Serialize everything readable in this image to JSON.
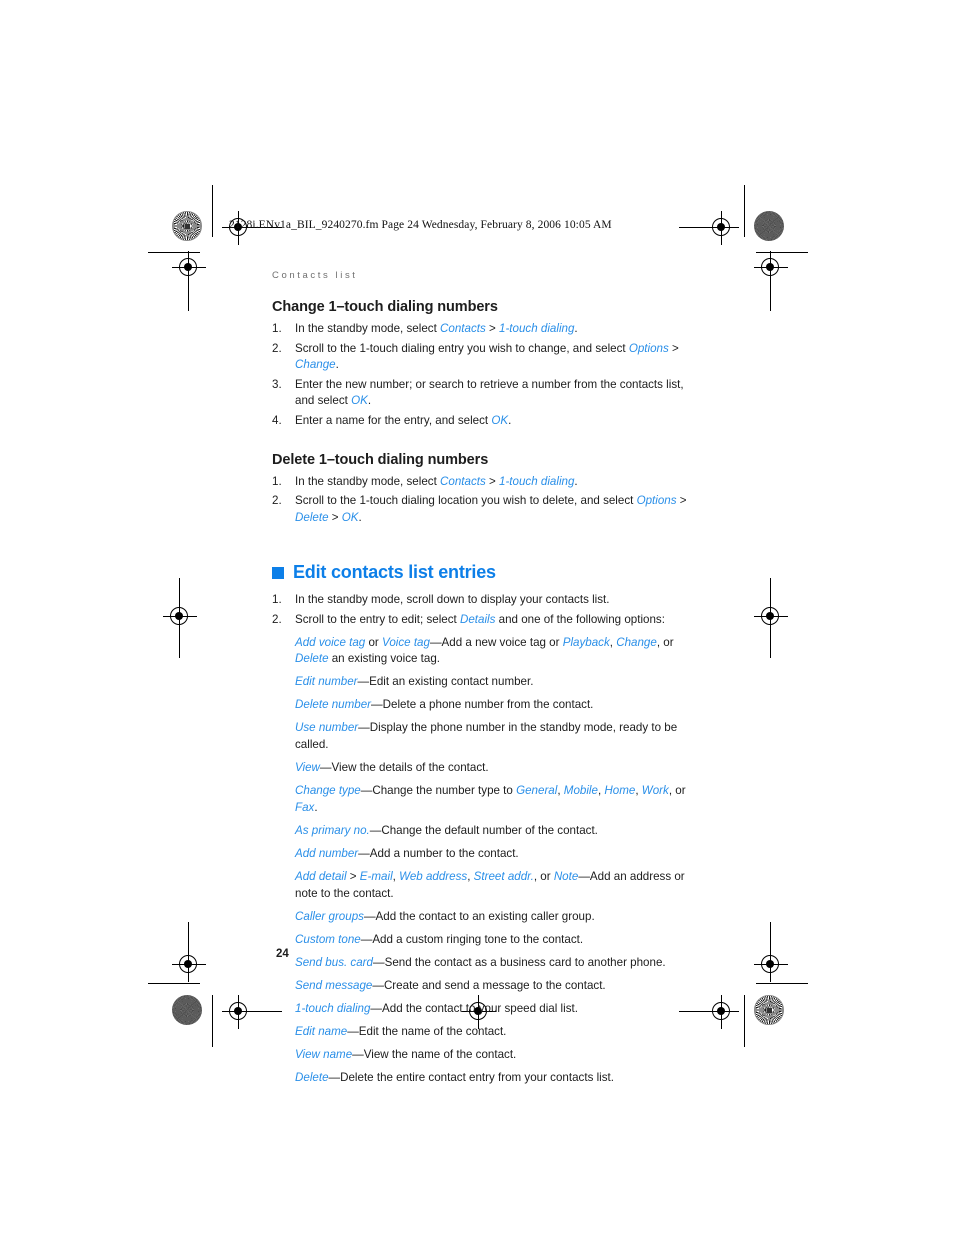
{
  "file_slug": "2128i.ENv1a_BIL_9240270.fm  Page 24  Wednesday, February 8, 2006  10:05 AM",
  "running_head": "Contacts list",
  "page_number": "24",
  "colors": {
    "accent_blue": "#0d7fe8",
    "ui_term_blue": "#2a8fe8",
    "body_text": "#1d1d1d",
    "running_head_gray": "#6f6f6f"
  },
  "sections": [
    {
      "heading": "Change 1–touch dialing numbers",
      "steps": [
        {
          "num": "1.",
          "parts": [
            {
              "t": "In the standby mode, select ",
              "s": "plain"
            },
            {
              "t": "Contacts",
              "s": "ui"
            },
            {
              "t": " > ",
              "s": "plain"
            },
            {
              "t": "1-touch dialing",
              "s": "ui"
            },
            {
              "t": ".",
              "s": "plain"
            }
          ]
        },
        {
          "num": "2.",
          "parts": [
            {
              "t": "Scroll to the 1-touch dialing entry you wish to change, and select ",
              "s": "plain"
            },
            {
              "t": "Options",
              "s": "ui"
            },
            {
              "t": " > ",
              "s": "plain"
            },
            {
              "t": "Change",
              "s": "ui"
            },
            {
              "t": ".",
              "s": "plain"
            }
          ]
        },
        {
          "num": "3.",
          "parts": [
            {
              "t": "Enter the new number; or search to retrieve a number from the contacts list, and select ",
              "s": "plain"
            },
            {
              "t": "OK",
              "s": "ui"
            },
            {
              "t": ".",
              "s": "plain"
            }
          ]
        },
        {
          "num": "4.",
          "parts": [
            {
              "t": "Enter a name for the entry, and select ",
              "s": "plain"
            },
            {
              "t": "OK",
              "s": "ui"
            },
            {
              "t": ".",
              "s": "plain"
            }
          ]
        }
      ]
    },
    {
      "heading": "Delete 1–touch dialing numbers",
      "steps": [
        {
          "num": "1.",
          "parts": [
            {
              "t": "In the standby mode, select ",
              "s": "plain"
            },
            {
              "t": "Contacts",
              "s": "ui"
            },
            {
              "t": " > ",
              "s": "plain"
            },
            {
              "t": "1-touch dialing",
              "s": "ui"
            },
            {
              "t": ".",
              "s": "plain"
            }
          ]
        },
        {
          "num": "2.",
          "parts": [
            {
              "t": "Scroll to the 1-touch dialing location you wish to delete, and select ",
              "s": "plain"
            },
            {
              "t": "Options",
              "s": "ui"
            },
            {
              "t": " > ",
              "s": "plain"
            },
            {
              "t": "Delete",
              "s": "ui"
            },
            {
              "t": " > ",
              "s": "plain"
            },
            {
              "t": "OK",
              "s": "ui"
            },
            {
              "t": ".",
              "s": "plain"
            }
          ]
        }
      ]
    }
  ],
  "main_section": {
    "bullet_icon": "blue-square-bullet",
    "heading": "Edit contacts list entries",
    "steps": [
      {
        "num": "1.",
        "parts": [
          {
            "t": "In the standby mode, scroll down to display your contacts list.",
            "s": "plain"
          }
        ]
      },
      {
        "num": "2.",
        "parts": [
          {
            "t": "Scroll to the entry to edit; select ",
            "s": "plain"
          },
          {
            "t": "Details",
            "s": "ui"
          },
          {
            "t": " and one of the following options:",
            "s": "plain"
          }
        ]
      }
    ],
    "options": [
      [
        {
          "t": "Add voice tag",
          "s": "ui"
        },
        {
          "t": " or ",
          "s": "plain"
        },
        {
          "t": "Voice tag",
          "s": "ui"
        },
        {
          "t": "—Add a new voice tag or ",
          "s": "plain"
        },
        {
          "t": "Playback",
          "s": "ui"
        },
        {
          "t": ", ",
          "s": "plain"
        },
        {
          "t": "Change",
          "s": "ui"
        },
        {
          "t": ", or ",
          "s": "plain"
        },
        {
          "t": "Delete",
          "s": "ui"
        },
        {
          "t": " an existing voice tag.",
          "s": "plain"
        }
      ],
      [
        {
          "t": "Edit number",
          "s": "ui"
        },
        {
          "t": "—Edit an existing contact number.",
          "s": "plain"
        }
      ],
      [
        {
          "t": "Delete number",
          "s": "ui"
        },
        {
          "t": "—Delete a phone number from the contact.",
          "s": "plain"
        }
      ],
      [
        {
          "t": "Use number",
          "s": "ui"
        },
        {
          "t": "—Display the phone number in the standby mode, ready to be called.",
          "s": "plain"
        }
      ],
      [
        {
          "t": "View",
          "s": "ui"
        },
        {
          "t": "—View the details of the contact.",
          "s": "plain"
        }
      ],
      [
        {
          "t": "Change type",
          "s": "ui"
        },
        {
          "t": "—Change the number type to ",
          "s": "plain"
        },
        {
          "t": "General",
          "s": "ui"
        },
        {
          "t": ", ",
          "s": "plain"
        },
        {
          "t": "Mobile",
          "s": "ui"
        },
        {
          "t": ", ",
          "s": "plain"
        },
        {
          "t": "Home",
          "s": "ui"
        },
        {
          "t": ", ",
          "s": "plain"
        },
        {
          "t": "Work",
          "s": "ui"
        },
        {
          "t": ", or ",
          "s": "plain"
        },
        {
          "t": "Fax",
          "s": "ui"
        },
        {
          "t": ".",
          "s": "plain"
        }
      ],
      [
        {
          "t": "As primary no.",
          "s": "ui"
        },
        {
          "t": "—Change the default number of the contact.",
          "s": "plain"
        }
      ],
      [
        {
          "t": "Add number",
          "s": "ui"
        },
        {
          "t": "—Add a number to the contact.",
          "s": "plain"
        }
      ],
      [
        {
          "t": "Add detail",
          "s": "ui"
        },
        {
          "t": " > ",
          "s": "plain"
        },
        {
          "t": "E-mail",
          "s": "ui"
        },
        {
          "t": ", ",
          "s": "plain"
        },
        {
          "t": "Web address",
          "s": "ui"
        },
        {
          "t": ", ",
          "s": "plain"
        },
        {
          "t": "Street addr.",
          "s": "ui"
        },
        {
          "t": ", or ",
          "s": "plain"
        },
        {
          "t": "Note",
          "s": "ui"
        },
        {
          "t": "—Add an address or note to the contact.",
          "s": "plain"
        }
      ],
      [
        {
          "t": "Caller groups",
          "s": "ui"
        },
        {
          "t": "—Add the contact to an existing caller group.",
          "s": "plain"
        }
      ],
      [
        {
          "t": "Custom tone",
          "s": "ui"
        },
        {
          "t": "—Add a custom ringing tone to the contact.",
          "s": "plain"
        }
      ],
      [
        {
          "t": "Send bus. card",
          "s": "ui"
        },
        {
          "t": "—Send the contact as a business card to another phone.",
          "s": "plain"
        }
      ],
      [
        {
          "t": "Send message",
          "s": "ui"
        },
        {
          "t": "—Create and send a message to the contact.",
          "s": "plain"
        }
      ],
      [
        {
          "t": "1-touch dialing",
          "s": "ui"
        },
        {
          "t": "—Add the contact to your speed dial list.",
          "s": "plain"
        }
      ],
      [
        {
          "t": "Edit name",
          "s": "ui"
        },
        {
          "t": "—Edit the name of the contact.",
          "s": "plain"
        }
      ],
      [
        {
          "t": "View name",
          "s": "ui"
        },
        {
          "t": "—View the name of the contact.",
          "s": "plain"
        }
      ],
      [
        {
          "t": "Delete",
          "s": "ui"
        },
        {
          "t": "—Delete the entire contact entry from your contacts list.",
          "s": "plain"
        }
      ]
    ]
  }
}
